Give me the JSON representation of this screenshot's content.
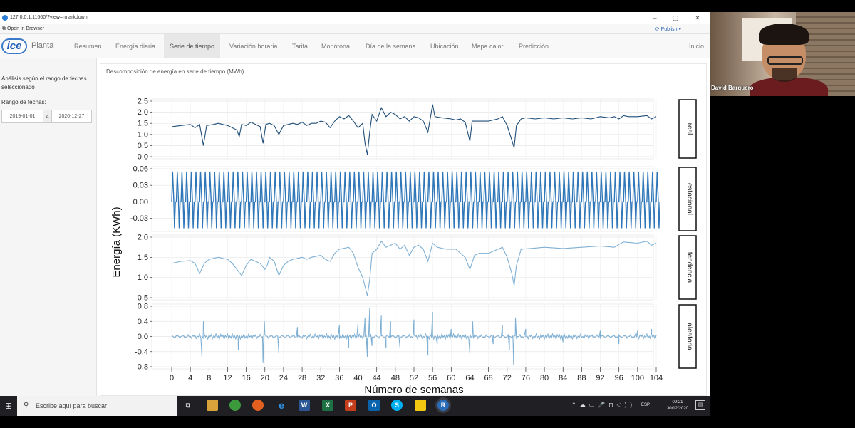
{
  "browser": {
    "url": "127.0.0.1:11660/?view=rmarkdown",
    "open_in_browser": "Open in Browser",
    "publish": "Publish",
    "min": "–",
    "max": "▢",
    "close": "✕"
  },
  "app": {
    "logo": "ice",
    "brand": "Planta",
    "tabs": [
      "Resumen",
      "Energía diaria",
      "Serie de tiempo",
      "Variación horaria",
      "Tarifa",
      "Monótona",
      "Día de la semana",
      "Ubicación",
      "Mapa calor",
      "Predicción"
    ],
    "active_tab": "Serie de tiempo",
    "inicio": "Inicio"
  },
  "sidebar": {
    "description": "Análisis según el rango de fechas seleccionado",
    "range_label": "Rango de fechas:",
    "date_start": "2019-01-01",
    "separator": "a",
    "date_end": "2020-12-27"
  },
  "panel": {
    "title": "Descomposición de energía en serie de tiempo (MWh)"
  },
  "chart_data": {
    "type": "line",
    "title": "Descomposición de energía en serie de tiempo (MWh)",
    "xlabel": "Número de semanas",
    "ylabel": "Energía (KWh)",
    "xlim": [
      0,
      104
    ],
    "x_ticks": [
      0,
      4,
      8,
      12,
      16,
      20,
      24,
      28,
      32,
      36,
      40,
      44,
      48,
      52,
      56,
      60,
      64,
      68,
      72,
      76,
      80,
      84,
      88,
      92,
      96,
      100,
      104
    ],
    "line_color": "#1f4e79",
    "series": [
      {
        "name": "real",
        "ylim": [
          0,
          2.5
        ],
        "y_ticks": [
          "0.0",
          "0.5",
          "1.0",
          "1.5",
          "2.0",
          "2.5"
        ],
        "points": [
          [
            0,
            1.35
          ],
          [
            2,
            1.4
          ],
          [
            4,
            1.45
          ],
          [
            5,
            1.3
          ],
          [
            6,
            1.45
          ],
          [
            6.8,
            0.5
          ],
          [
            7.5,
            1.4
          ],
          [
            9,
            1.45
          ],
          [
            10,
            1.5
          ],
          [
            11,
            1.45
          ],
          [
            12,
            1.4
          ],
          [
            13,
            1.3
          ],
          [
            14,
            1.2
          ],
          [
            14.5,
            0.9
          ],
          [
            15,
            1.45
          ],
          [
            16,
            1.4
          ],
          [
            17,
            1.55
          ],
          [
            18,
            1.45
          ],
          [
            19,
            1.35
          ],
          [
            19.6,
            0.6
          ],
          [
            20.2,
            1.45
          ],
          [
            21,
            1.5
          ],
          [
            22,
            1.4
          ],
          [
            23,
            1.0
          ],
          [
            24,
            1.4
          ],
          [
            25,
            1.45
          ],
          [
            26,
            1.5
          ],
          [
            27,
            1.45
          ],
          [
            28,
            1.55
          ],
          [
            29,
            1.4
          ],
          [
            30,
            1.5
          ],
          [
            31,
            1.5
          ],
          [
            32,
            1.6
          ],
          [
            33,
            1.55
          ],
          [
            34,
            1.3
          ],
          [
            35,
            1.6
          ],
          [
            36,
            1.8
          ],
          [
            37,
            1.7
          ],
          [
            38,
            1.85
          ],
          [
            39,
            1.6
          ],
          [
            40,
            1.3
          ],
          [
            41,
            1.5
          ],
          [
            41.5,
            0.6
          ],
          [
            42,
            0.1
          ],
          [
            42.5,
            1.1
          ],
          [
            43,
            1.9
          ],
          [
            44,
            1.6
          ],
          [
            45,
            2.2
          ],
          [
            46,
            1.8
          ],
          [
            47,
            2.0
          ],
          [
            48,
            1.9
          ],
          [
            49,
            1.7
          ],
          [
            50,
            1.8
          ],
          [
            51,
            1.6
          ],
          [
            52,
            1.8
          ],
          [
            53,
            1.75
          ],
          [
            54,
            1.6
          ],
          [
            55,
            1.1
          ],
          [
            56,
            2.35
          ],
          [
            56.5,
            1.8
          ],
          [
            58,
            1.75
          ],
          [
            60,
            1.7
          ],
          [
            61,
            1.65
          ],
          [
            62,
            1.7
          ],
          [
            63,
            1.55
          ],
          [
            64,
            0.7
          ],
          [
            64.5,
            1.6
          ],
          [
            66,
            1.6
          ],
          [
            68,
            1.6
          ],
          [
            69,
            1.65
          ],
          [
            70,
            1.7
          ],
          [
            71,
            1.8
          ],
          [
            72,
            1.4
          ],
          [
            73,
            0.75
          ],
          [
            73.5,
            0.4
          ],
          [
            74,
            1.4
          ],
          [
            75,
            1.7
          ],
          [
            76,
            1.75
          ],
          [
            78,
            1.7
          ],
          [
            80,
            1.75
          ],
          [
            82,
            1.7
          ],
          [
            84,
            1.75
          ],
          [
            86,
            1.7
          ],
          [
            88,
            1.75
          ],
          [
            90,
            1.7
          ],
          [
            92,
            1.8
          ],
          [
            94,
            1.75
          ],
          [
            95,
            1.8
          ],
          [
            96,
            1.7
          ],
          [
            97,
            1.85
          ],
          [
            98,
            1.8
          ],
          [
            100,
            1.8
          ],
          [
            102,
            1.85
          ],
          [
            103,
            1.7
          ],
          [
            104,
            1.8
          ]
        ]
      },
      {
        "name": "estacional",
        "ylim": [
          -0.05,
          0.06
        ],
        "y_ticks": [
          "-0.03",
          "0.00",
          "0.03",
          "0.06"
        ],
        "period_weeks": 1,
        "amplitude": [
          -0.048,
          0.055
        ]
      },
      {
        "name": "tendencia",
        "ylim": [
          0.5,
          2.0
        ],
        "y_ticks": [
          "0.5",
          "1.0",
          "1.5",
          "2.0"
        ],
        "points": [
          [
            0,
            1.35
          ],
          [
            2,
            1.4
          ],
          [
            4,
            1.42
          ],
          [
            5,
            1.35
          ],
          [
            6,
            1.1
          ],
          [
            7,
            1.35
          ],
          [
            8,
            1.45
          ],
          [
            10,
            1.5
          ],
          [
            12,
            1.45
          ],
          [
            13,
            1.35
          ],
          [
            14,
            1.2
          ],
          [
            15,
            1.05
          ],
          [
            16,
            1.3
          ],
          [
            17,
            1.45
          ],
          [
            18,
            1.4
          ],
          [
            19,
            1.35
          ],
          [
            20,
            1.2
          ],
          [
            20.5,
            1.3
          ],
          [
            21,
            1.5
          ],
          [
            22,
            1.4
          ],
          [
            23,
            1.05
          ],
          [
            24,
            1.3
          ],
          [
            25,
            1.4
          ],
          [
            26,
            1.45
          ],
          [
            28,
            1.5
          ],
          [
            29,
            1.45
          ],
          [
            30,
            1.5
          ],
          [
            32,
            1.55
          ],
          [
            33,
            1.45
          ],
          [
            34,
            1.4
          ],
          [
            35,
            1.6
          ],
          [
            36,
            1.7
          ],
          [
            38,
            1.75
          ],
          [
            39,
            1.6
          ],
          [
            40,
            1.25
          ],
          [
            41,
            1.0
          ],
          [
            42,
            0.55
          ],
          [
            42.5,
            0.95
          ],
          [
            43,
            1.6
          ],
          [
            44,
            1.7
          ],
          [
            45,
            1.9
          ],
          [
            46,
            1.75
          ],
          [
            47,
            1.8
          ],
          [
            48,
            1.85
          ],
          [
            49,
            1.7
          ],
          [
            50,
            1.8
          ],
          [
            51,
            1.55
          ],
          [
            52,
            1.75
          ],
          [
            53,
            1.8
          ],
          [
            54,
            1.7
          ],
          [
            55,
            1.4
          ],
          [
            56,
            1.85
          ],
          [
            57,
            1.75
          ],
          [
            59,
            1.7
          ],
          [
            61,
            1.7
          ],
          [
            63,
            1.5
          ],
          [
            64,
            1.2
          ],
          [
            65,
            1.55
          ],
          [
            66,
            1.6
          ],
          [
            68,
            1.6
          ],
          [
            70,
            1.7
          ],
          [
            71,
            1.75
          ],
          [
            72,
            1.5
          ],
          [
            73,
            1.1
          ],
          [
            73.5,
            0.8
          ],
          [
            74,
            1.3
          ],
          [
            75,
            1.7
          ],
          [
            77,
            1.72
          ],
          [
            80,
            1.75
          ],
          [
            84,
            1.72
          ],
          [
            88,
            1.75
          ],
          [
            92,
            1.78
          ],
          [
            95,
            1.75
          ],
          [
            96,
            1.82
          ],
          [
            97,
            1.88
          ],
          [
            100,
            1.85
          ],
          [
            102,
            1.9
          ],
          [
            103,
            1.8
          ],
          [
            104,
            1.85
          ]
        ]
      },
      {
        "name": "aleatoria",
        "ylim": [
          -0.8,
          0.8
        ],
        "y_ticks": [
          "-0.8",
          "-0.4",
          "0.0",
          "0.4",
          "0.8"
        ],
        "spikes": [
          [
            6.5,
            -0.55
          ],
          [
            6.8,
            0.4
          ],
          [
            14.3,
            -0.35
          ],
          [
            19.6,
            -0.7
          ],
          [
            19.9,
            0.4
          ],
          [
            23,
            -0.45
          ],
          [
            27,
            0.25
          ],
          [
            36,
            0.3
          ],
          [
            38,
            -0.3
          ],
          [
            40,
            0.35
          ],
          [
            41.5,
            0.5
          ],
          [
            42,
            -0.55
          ],
          [
            42.5,
            0.75
          ],
          [
            43,
            -0.25
          ],
          [
            45,
            0.55
          ],
          [
            46,
            -0.3
          ],
          [
            47,
            0.4
          ],
          [
            49,
            -0.3
          ],
          [
            52,
            0.45
          ],
          [
            55,
            -0.5
          ],
          [
            56,
            0.65
          ],
          [
            57,
            -0.2
          ],
          [
            60,
            0.2
          ],
          [
            64,
            -0.45
          ],
          [
            64.6,
            0.4
          ],
          [
            69,
            -0.2
          ],
          [
            71,
            0.3
          ],
          [
            72.5,
            -0.35
          ],
          [
            73.4,
            -0.75
          ],
          [
            73.8,
            0.5
          ],
          [
            76,
            0.2
          ],
          [
            84,
            -0.15
          ],
          [
            92,
            0.15
          ],
          [
            96,
            -0.2
          ],
          [
            100,
            0.15
          ],
          [
            103,
            0.2
          ]
        ]
      }
    ]
  },
  "taskbar": {
    "search_placeholder": "Escribe aquí para buscar",
    "lang": "ESP",
    "time": "09:21",
    "date": "30/12/2020"
  },
  "cam": {
    "name": "David Barquero"
  }
}
